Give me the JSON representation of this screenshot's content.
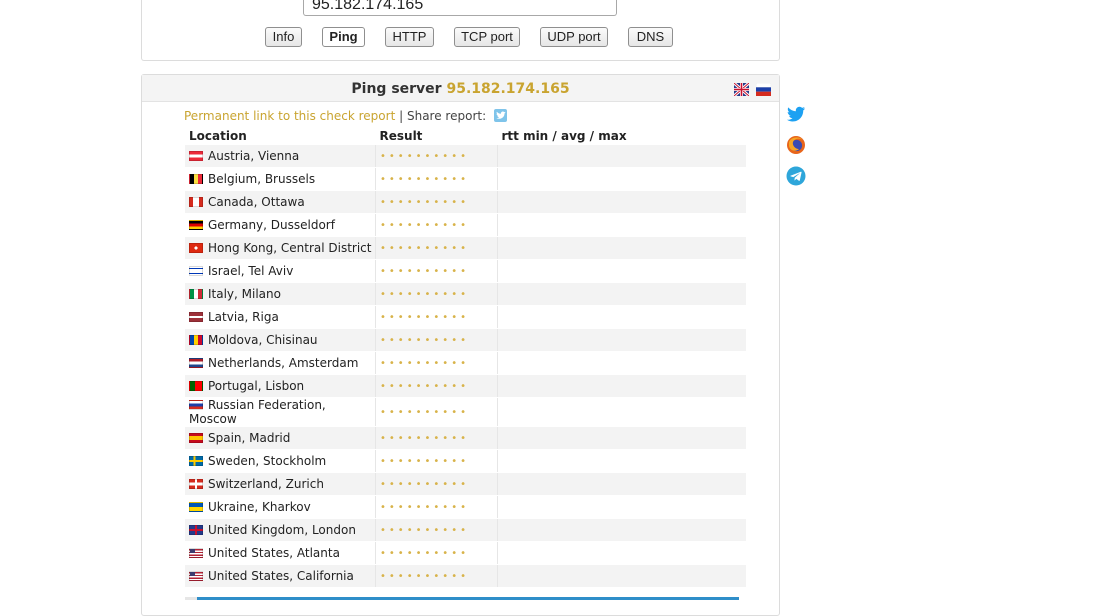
{
  "form": {
    "host_value": "95.182.174.165",
    "buttons": [
      "Info",
      "Ping",
      "HTTP",
      "TCP port",
      "UDP port",
      "DNS"
    ],
    "active_button": "Ping"
  },
  "report": {
    "title_prefix": "Ping server",
    "title_ip": "95.182.174.165",
    "permanent_link": "Permanent link to this check report",
    "separator": "|",
    "share_label": "Share report:",
    "columns": [
      "Location",
      "Result",
      "rtt min / avg / max"
    ],
    "rows": [
      {
        "location": "Austria, Vienna",
        "flag": "at",
        "result": "••••••••••",
        "rtt": ""
      },
      {
        "location": "Belgium, Brussels",
        "flag": "be",
        "result": "••••••••••",
        "rtt": ""
      },
      {
        "location": "Canada, Ottawa",
        "flag": "ca",
        "result": "••••••••••",
        "rtt": ""
      },
      {
        "location": "Germany, Dusseldorf",
        "flag": "de",
        "result": "••••••••••",
        "rtt": ""
      },
      {
        "location": "Hong Kong, Central District",
        "flag": "hk",
        "result": "••••••••••",
        "rtt": ""
      },
      {
        "location": "Israel, Tel Aviv",
        "flag": "il",
        "result": "••••••••••",
        "rtt": ""
      },
      {
        "location": "Italy, Milano",
        "flag": "it",
        "result": "••••••••••",
        "rtt": ""
      },
      {
        "location": "Latvia, Riga",
        "flag": "lv",
        "result": "••••••••••",
        "rtt": ""
      },
      {
        "location": "Moldova, Chisinau",
        "flag": "md",
        "result": "••••••••••",
        "rtt": ""
      },
      {
        "location": "Netherlands, Amsterdam",
        "flag": "nl",
        "result": "••••••••••",
        "rtt": ""
      },
      {
        "location": "Portugal, Lisbon",
        "flag": "pt",
        "result": "••••••••••",
        "rtt": ""
      },
      {
        "location": "Russian Federation, Moscow",
        "flag": "ru",
        "result": "••••••••••",
        "rtt": ""
      },
      {
        "location": "Spain, Madrid",
        "flag": "es",
        "result": "••••••••••",
        "rtt": ""
      },
      {
        "location": "Sweden, Stockholm",
        "flag": "se",
        "result": "••••••••••",
        "rtt": ""
      },
      {
        "location": "Switzerland, Zurich",
        "flag": "ch",
        "result": "••••••••••",
        "rtt": ""
      },
      {
        "location": "Ukraine, Kharkov",
        "flag": "ua",
        "result": "••••••••••",
        "rtt": ""
      },
      {
        "location": "United Kingdom, London",
        "flag": "gb",
        "result": "••••••••••",
        "rtt": ""
      },
      {
        "location": "United States, Atlanta",
        "flag": "us",
        "result": "••••••••••",
        "rtt": ""
      },
      {
        "location": "United States, California",
        "flag": "us",
        "result": "••••••••••",
        "rtt": ""
      }
    ]
  },
  "colors": {
    "accent_gold": "#c9a430",
    "twitter_blue": "#1da1f2",
    "telegram_blue": "#2ea6da",
    "progress_blue": "#2f8ec9"
  },
  "icons": {
    "language_en": "uk-flag-icon",
    "language_ru": "russia-flag-icon",
    "share_twitter_small": "twitter-small-icon",
    "side": [
      "twitter-icon",
      "firefox-icon",
      "telegram-icon"
    ]
  }
}
